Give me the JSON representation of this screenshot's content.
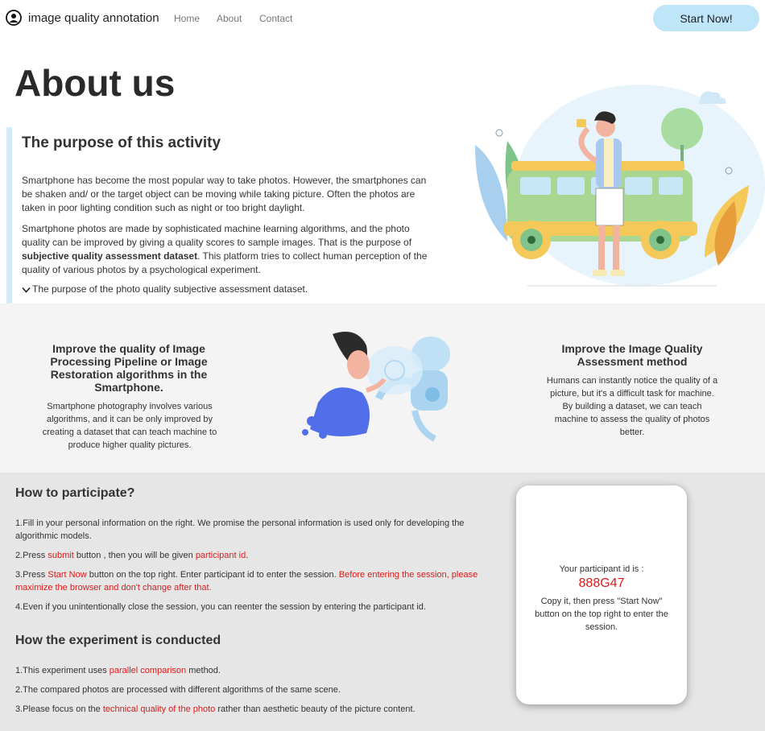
{
  "nav": {
    "brand": "image quality annotation",
    "links": [
      "Home",
      "About",
      "Contact"
    ],
    "cta": "Start Now!"
  },
  "about": {
    "title": "About us",
    "purpose_title": "The purpose of this activity",
    "para1": "Smartphone has become the most popular way to take photos. However, the smartphones can be shaken and/ or the target object can be moving while taking picture. Often the photos are taken in poor lighting condition such as night or too bright daylight.",
    "para2_a": "Smartphone photos are made by sophisticated machine learning algorithms, and the photo quality can be improved by giving a quality scores to sample images. That is the purpose of ",
    "para2_bold": "subjective quality assessment dataset",
    "para2_b": ". This platform tries to collect human perception of the quality of various photos by a psychological experiment.",
    "toggle": "The purpose of the photo quality subjective assessment dataset."
  },
  "features": {
    "left_title": "Improve the quality of Image Processing Pipeline or Image Restoration algorithms in the Smartphone.",
    "left_text": "Smartphone photography involves various algorithms, and it can be only improved by creating a dataset that can teach machine to produce higher quality pictures.",
    "right_title": "Improve the Image Quality Assessment method",
    "right_text": "Humans can instantly notice the quality of a picture, but it's a difficult task for machine. By building a dataset, we can teach machine to assess the quality of photos better."
  },
  "participate": {
    "title": "How to participate?",
    "s1": "1.Fill in your personal information on the right. We promise the personal information is used only for developing the algorithmic models.",
    "s2_a": "2.Press ",
    "s2_red1": "submit",
    "s2_b": " button , then you will be given ",
    "s2_red2": "participant id",
    "s2_c": ".",
    "s3_a": "3.Press ",
    "s3_red1": "Start Now",
    "s3_b": " button on the top right. Enter participant id to enter the session. ",
    "s3_red2": "Before entering the session, please maximize the browser and don't change after that.",
    "s4": "4.Even if you unintentionally close the session, you can reenter the session by entering the participant id."
  },
  "experiment": {
    "title": "How the experiment is conducted",
    "e1_a": "1.This experiment uses ",
    "e1_red": "parallel comparison",
    "e1_b": " method.",
    "e2": "2.The compared photos are processed with different algorithms of the same scene.",
    "e3_a": "3.Please focus on the ",
    "e3_red": "technical quality of the photo",
    "e3_b": " rather than aesthetic beauty of the picture content."
  },
  "id_card": {
    "label": "Your participant id is :",
    "value": "888G47",
    "hint": "Copy it, then press \"Start Now\" button on the top right to enter the session."
  },
  "colors": {
    "accent_red": "#e0191a",
    "cta_bg": "#bfe5f9",
    "band_light": "#f4f4f4",
    "band_dark": "#e6e6e6"
  }
}
